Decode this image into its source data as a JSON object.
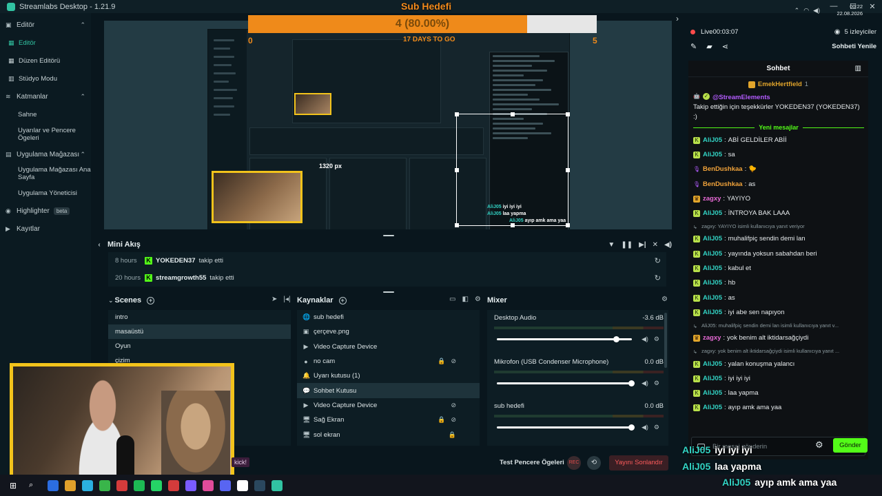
{
  "window": {
    "title": "Streamlabs Desktop - 1.21.9",
    "controls": [
      "—",
      "☐",
      "✕"
    ]
  },
  "sidebar": {
    "groups": [
      {
        "label": "Editör",
        "items": [
          {
            "label": "Editör",
            "active": true
          },
          {
            "label": "Düzen Editörü"
          },
          {
            "label": "Stüdyo Modu"
          }
        ]
      },
      {
        "label": "Katmanlar",
        "items": [
          {
            "label": "Sahne"
          },
          {
            "label": "Uyarılar ve Pencere Ögeleri"
          }
        ]
      },
      {
        "label": "Uygulama Mağazası",
        "items": [
          {
            "label": "Uygulama Mağazası Ana Sayfa"
          },
          {
            "label": "Uygulama Yöneticisi"
          }
        ]
      }
    ],
    "highlighter": "Highlighter",
    "beta": "beta",
    "kayitlar": "Kayıtlar"
  },
  "preview": {
    "goal_title": "Sub Hedefi",
    "goal_text": "4 (80.00%)",
    "goal_progress": 0.8,
    "goal_min": "0",
    "goal_max": "5",
    "goal_days": "17 DAYS TO GO",
    "px_label": "1320 px",
    "chat_lines": [
      {
        "user": "AliJ05",
        "text": "iyi iyi iyi"
      },
      {
        "user": "AliJ05",
        "text": "laa yapma"
      },
      {
        "user": "AliJ05",
        "text": "ayıp amk ama yaa"
      }
    ]
  },
  "mini_feed": {
    "title": "Mini Akış",
    "events": [
      {
        "time": "8 hours",
        "name": "YOKEDEN37",
        "action": "takip etti"
      },
      {
        "time": "20 hours",
        "name": "streamgrowth55",
        "action": "takip etti"
      }
    ]
  },
  "scenes": {
    "title": "Scenes",
    "items": [
      "intro",
      "masaüstü",
      "Oyun",
      "çizim"
    ],
    "selected_index": 1
  },
  "sources": {
    "title": "Kaynaklar",
    "items": [
      {
        "label": "sub hedefi",
        "icon": "🌐",
        "flags": []
      },
      {
        "label": "çerçeve.png",
        "icon": "▣",
        "flags": []
      },
      {
        "label": "Video Capture Device",
        "icon": "▶",
        "flags": []
      },
      {
        "label": "no cam",
        "icon": "●",
        "flags": [
          "🔒",
          "⊘"
        ]
      },
      {
        "label": "Uyarı kutusu (1)",
        "icon": "🔔",
        "flags": []
      },
      {
        "label": "Sohbet Kutusu",
        "icon": "💬",
        "flags": []
      },
      {
        "label": "Video Capture Device",
        "icon": "▶",
        "flags": [
          "⊘"
        ]
      },
      {
        "label": "Sağ Ekran",
        "icon": "🖥",
        "flags": [
          "🔒",
          "⊘"
        ]
      },
      {
        "label": "sol ekran",
        "icon": "🖥",
        "flags": [
          "🔒"
        ]
      }
    ],
    "selected_index": 5
  },
  "mixer": {
    "title": "Mixer",
    "channels": [
      {
        "name": "Desktop Audio",
        "db": "-3.6 dB",
        "level": 0.89
      },
      {
        "name": "Mikrofon (USB Condenser Microphone)",
        "db": "0.0 dB",
        "level": 1.0
      },
      {
        "name": "sub hedefi",
        "db": "0.0 dB",
        "level": 1.0
      }
    ]
  },
  "footer": {
    "test_label": "Test Pencere Ögeleri",
    "rec_label": "REC",
    "end_stream": "Yayını Sonlandır",
    "kick_tag": "kick!"
  },
  "right_panel": {
    "live_label": "Live",
    "live_time": "00:03:07",
    "viewers": "5 izleyiciler",
    "refresh_chat": "Sohbeti Yenile",
    "chat_title": "Sohbet",
    "pinned_user": "EmekHertfield",
    "pinned_count": "1",
    "new_messages": "Yeni mesajlar",
    "input_placeholder": "Bir mesaj gönderin",
    "send": "Gönder"
  },
  "chat": {
    "bot_user": "@StreamElements",
    "bot_text": "Takip ettiğin için teşekkürler YOKEDEN37 (YOKEDEN37) :)",
    "messages": [
      {
        "kind": "msg",
        "badge": "green",
        "user": "AliJ05",
        "color": "#32d3c4",
        "text": "ABİ GELDİLER ABİİ"
      },
      {
        "kind": "msg",
        "badge": "green",
        "user": "AliJ05",
        "color": "#32d3c4",
        "text": "sa"
      },
      {
        "kind": "msg",
        "badge": "mic",
        "user": "BenDushkaa",
        "color": "#f0a23a",
        "text": "🐤"
      },
      {
        "kind": "msg",
        "badge": "mic",
        "user": "BenDushkaa",
        "color": "#f0a23a",
        "text": "as"
      },
      {
        "kind": "msg",
        "badge": "crown",
        "user": "zagxy",
        "color": "#e86ad6",
        "text": "YAYIYO"
      },
      {
        "kind": "msg",
        "badge": "green",
        "user": "AliJ05",
        "color": "#32d3c4",
        "text": "İNTROYA BAK LAAA"
      },
      {
        "kind": "sys",
        "text": "zagxy: YAYIYO isimli kullanıcıya yanıt veriyor"
      },
      {
        "kind": "msg",
        "badge": "green",
        "user": "AliJ05",
        "color": "#32d3c4",
        "text": "muhalifpiç sendin demi lan"
      },
      {
        "kind": "msg",
        "badge": "green",
        "user": "AliJ05",
        "color": "#32d3c4",
        "text": "yayında yoksun sabahdan beri"
      },
      {
        "kind": "msg",
        "badge": "green",
        "user": "AliJ05",
        "color": "#32d3c4",
        "text": "kabul et"
      },
      {
        "kind": "msg",
        "badge": "green",
        "user": "AliJ05",
        "color": "#32d3c4",
        "text": "hb"
      },
      {
        "kind": "msg",
        "badge": "green",
        "user": "AliJ05",
        "color": "#32d3c4",
        "text": "as"
      },
      {
        "kind": "msg",
        "badge": "green",
        "user": "AliJ05",
        "color": "#32d3c4",
        "text": "iyi abe sen napıyon"
      },
      {
        "kind": "sys",
        "text": "AliJ05: muhalifpiç sendin demi lan isimli kullanıcıya yanıt v..."
      },
      {
        "kind": "msg",
        "badge": "crown",
        "user": "zagxy",
        "color": "#e86ad6",
        "text": "yok benim alt iktidarsağçiydi"
      },
      {
        "kind": "sys",
        "text": "zagxy: yok benim alt iktidarsağçiydi isimli kullanıcıya yanıt ..."
      },
      {
        "kind": "msg",
        "badge": "green",
        "user": "AliJ05",
        "color": "#32d3c4",
        "text": "yalan konuşma yalancı"
      },
      {
        "kind": "msg",
        "badge": "green",
        "user": "AliJ05",
        "color": "#32d3c4",
        "text": "iyi iyi iyi"
      },
      {
        "kind": "msg",
        "badge": "green",
        "user": "AliJ05",
        "color": "#32d3c4",
        "text": "laa yapma"
      },
      {
        "kind": "msg",
        "badge": "green",
        "user": "AliJ05",
        "color": "#32d3c4",
        "text": "ayıp amk ama yaa"
      }
    ]
  },
  "overlay_chat": [
    {
      "user": "AliJ05",
      "text": "iyi iyi iyi"
    },
    {
      "user": "AliJ05",
      "text": "laa yapma"
    },
    {
      "user": "AliJ05",
      "text": "ayıp amk ama yaa"
    }
  ],
  "taskbar": {
    "time": "00:22",
    "date": "22.08.2026",
    "icon_colors": [
      "#2b6de0",
      "#e0a02b",
      "#2bb0e0",
      "#39b54a",
      "#d43b3b",
      "#1db954",
      "#25d366",
      "#d43b3b",
      "#7a5cff",
      "#e04b9a",
      "#5865f2",
      "#ffffff",
      "#2a475e",
      "#31c3a2"
    ]
  }
}
